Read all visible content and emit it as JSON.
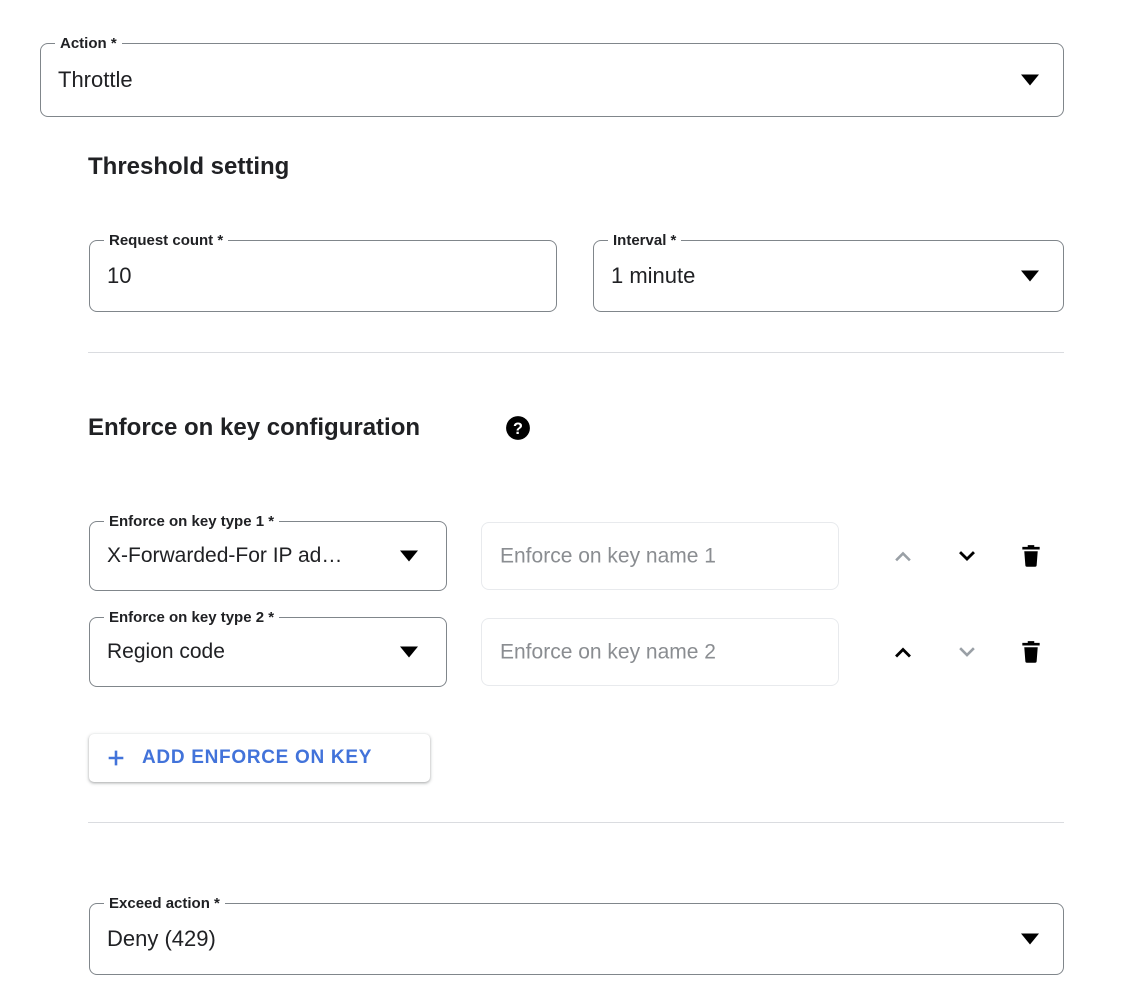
{
  "action_field": {
    "label": "Action *",
    "value": "Throttle",
    "icon": "chevron-down-icon"
  },
  "threshold": {
    "heading": "Threshold setting",
    "request_count": {
      "label": "Request count *",
      "value": "10"
    },
    "interval": {
      "label": "Interval *",
      "value": "1 minute",
      "icon": "chevron-down-icon"
    }
  },
  "enforce_on_key": {
    "heading": "Enforce on key configuration",
    "help_icon": "help-circle-icon",
    "rows": [
      {
        "type_label": "Enforce on key type 1 *",
        "type_value": "X-Forwarded-For IP ad…",
        "name_placeholder": "Enforce on key name 1",
        "name_value": "",
        "move_up_icon": "chevron-up-icon",
        "move_down_icon": "chevron-down-icon",
        "delete_icon": "trash-icon",
        "move_up_enabled": false,
        "move_down_enabled": true
      },
      {
        "type_label": "Enforce on key type 2 *",
        "type_value": "Region code",
        "name_placeholder": "Enforce on key name 2",
        "name_value": "",
        "move_up_icon": "chevron-up-icon",
        "move_down_icon": "chevron-down-icon",
        "delete_icon": "trash-icon",
        "move_up_enabled": true,
        "move_down_enabled": false
      }
    ],
    "add_button": {
      "label": "ADD ENFORCE ON KEY",
      "icon": "plus-icon"
    }
  },
  "exceed_action": {
    "label": "Exceed action *",
    "value": "Deny (429)",
    "icon": "chevron-down-icon"
  },
  "colors": {
    "accent_blue": "#4273da",
    "field_border": "#80868b",
    "disabled_border": "#e8eaed",
    "divider": "#dadce0",
    "placeholder_text": "#8a8d91",
    "icon_enabled": "#000000",
    "icon_disabled": "#9aa0a6"
  }
}
